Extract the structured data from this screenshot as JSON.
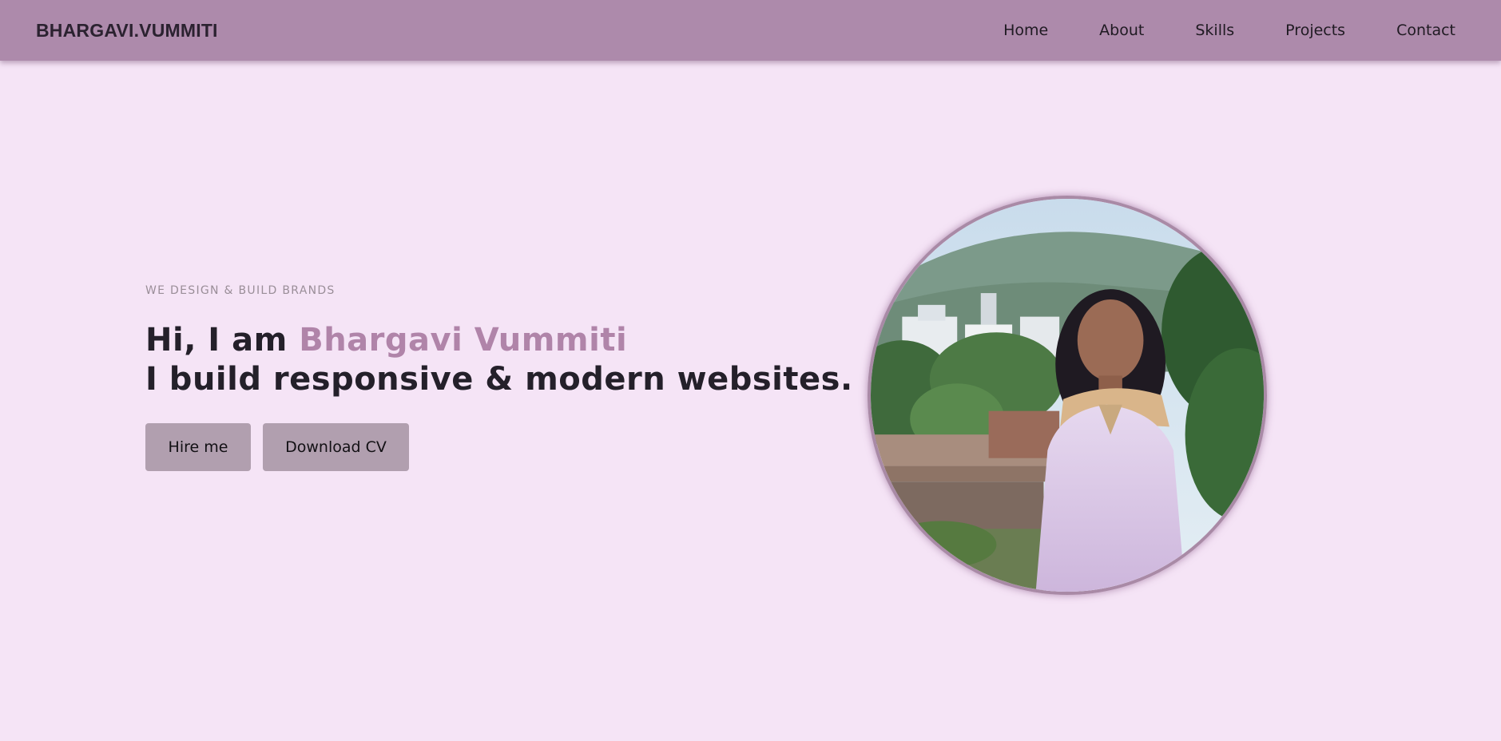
{
  "header": {
    "brand": "BHARGAVI.VUMMITI",
    "nav": [
      "Home",
      "About",
      "Skills",
      "Projects",
      "Contact"
    ]
  },
  "hero": {
    "tagline": "WE DESIGN & BUILD BRANDS",
    "greeting": "Hi, I am ",
    "name": "Bhargavi Vummiti",
    "subtitle": "I build responsive & modern websites.",
    "buttons": {
      "hire": "Hire me",
      "cv": "Download CV"
    }
  },
  "colors": {
    "background": "#f5e4f6",
    "navbar": "#ad8aab",
    "accent": "#b084a9",
    "button": "#b19faf"
  }
}
